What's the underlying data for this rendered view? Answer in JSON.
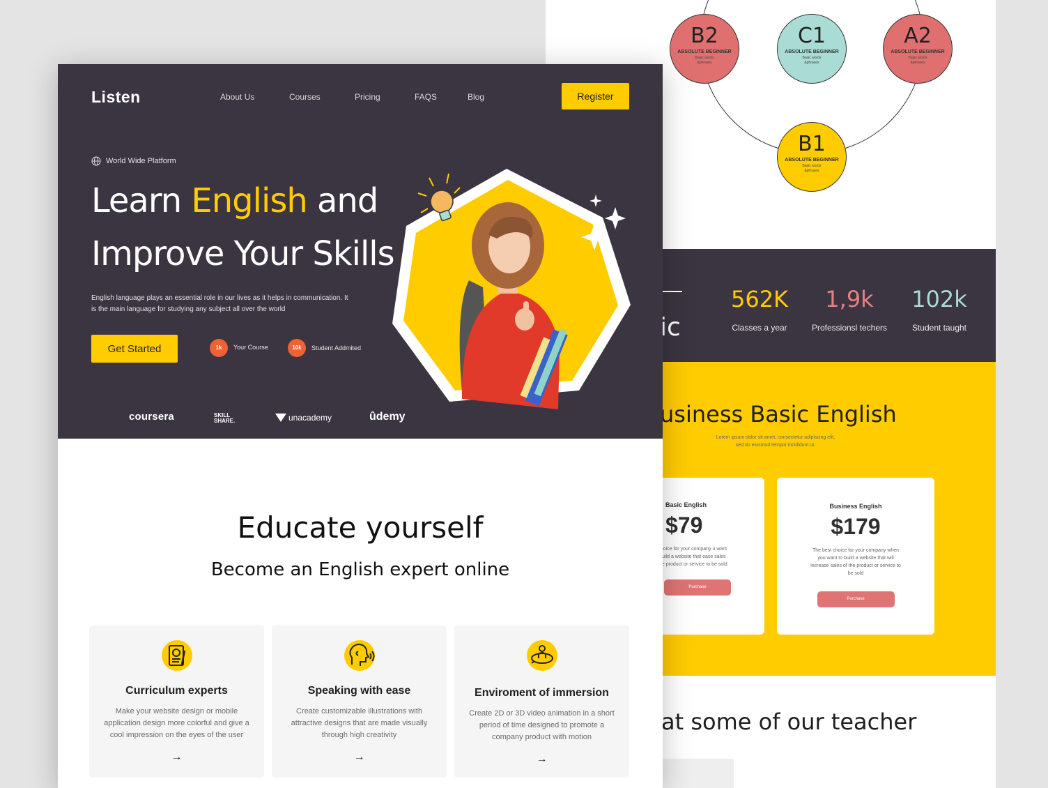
{
  "levels": [
    {
      "code": "B2",
      "title": "ABSOLUTE BEGINNER",
      "line1": "Basic words",
      "line2": "&phrases",
      "color": "#e07070"
    },
    {
      "code": "C1",
      "title": "ABSOLUTE BEGINNER",
      "line1": "Basic words",
      "line2": "&phrases",
      "color": "#a8dcd4"
    },
    {
      "code": "A2",
      "title": "ABSOLUTE BEGINNER",
      "line1": "Basic words",
      "line2": "&phrases",
      "color": "#e07070"
    },
    {
      "code": "B1",
      "title": "ABSOLUTE BEGINNER",
      "line1": "Basic words",
      "line2": "&phrases",
      "color": "#ffcc00"
    }
  ],
  "stats_partial_heading": "ic",
  "stats": [
    {
      "value": "562K",
      "label": "Classes a year",
      "color": "#ffcc00"
    },
    {
      "value": "1,9k",
      "label": "Professionsl techers",
      "color": "#e88080"
    },
    {
      "value": "102k",
      "label": "Student taught",
      "color": "#a8dcd4"
    }
  ],
  "pricing": {
    "title": "usiness Basic English",
    "subtitle_line1": "Lorem ipsum dolor sit amet, consectetur adipiscing elit,",
    "subtitle_line2": "sed do eiusmod tempor incididunt ut.",
    "cards": [
      {
        "name": "Basic English",
        "price": "$79",
        "desc": "st choice for your company u want to build a website that ease sales of the product or service to be sold",
        "button": "Purchase"
      },
      {
        "name": "Business English",
        "price": "$179",
        "desc": "The best choice for your company when you want to build a website that will increase sales of the product or service to be sold",
        "button": "Purchase"
      }
    ]
  },
  "teachers_heading": "at some of our teacher",
  "header": {
    "logo": "Listen",
    "nav": [
      "About Us",
      "Courses",
      "Pricing",
      "FAQS",
      "Blog"
    ],
    "register": "Register"
  },
  "hero": {
    "tag": "World Wide Platform",
    "title_1": "Learn ",
    "title_highlight": "English",
    "title_2": " and",
    "title_3": "Improve Your Skills",
    "description_line1": "English language plays an essential role in our lives as it helps in communication. It",
    "description_line2": "is the main language for studying any subject all over the world",
    "cta": "Get Started",
    "badge1_value": "1k",
    "badge1_label": "Your Course",
    "badge2_value": "10k",
    "badge2_label": "Student Addmited"
  },
  "partners": [
    "coursera",
    "SKILL SHARE.",
    "unacademy",
    "ûdemy"
  ],
  "educate": {
    "title": "Educate yourself",
    "subtitle": "Become an English expert online"
  },
  "features": [
    {
      "title": "Curriculum experts",
      "text": "Make your website design or mobile application design more colorful and give a cool impression on the eyes of the user",
      "icon": "certificate-icon"
    },
    {
      "title": "Speaking with ease",
      "text": "Create customizable illustrations with attractive designs that are made visually through high creativity",
      "icon": "speaking-head-icon"
    },
    {
      "title": "Enviroment of immersion",
      "text": "Create 2D or 3D video animation in a short period of time designed to promote a company product with motion",
      "icon": "immersion-icon"
    }
  ],
  "colors": {
    "dark": "#3b3541",
    "accent": "#ffcc00",
    "coral": "#e07373",
    "mint": "#a8dcd4"
  }
}
